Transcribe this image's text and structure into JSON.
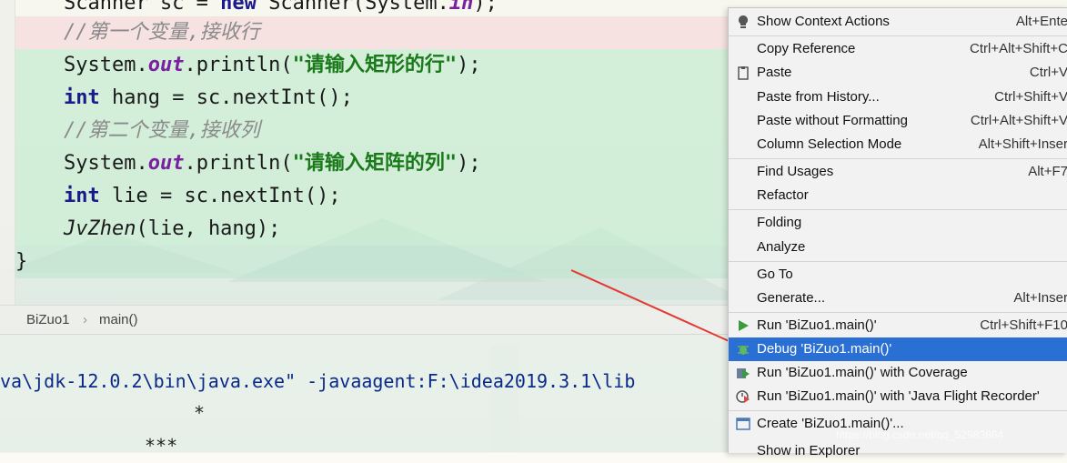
{
  "editor": {
    "lines": [
      {
        "code": "    Scanner sc = new Scanner(System.in);"
      },
      {
        "code": "    //第一个变量,接收行"
      },
      {
        "code": "    System.out.println(\"请输入矩形的行\");"
      },
      {
        "code": "    int hang = sc.nextInt();"
      },
      {
        "code": "    //第二个变量,接收列"
      },
      {
        "code": "    System.out.println(\"请输入矩阵的列\");"
      },
      {
        "code": "    int lie = sc.nextInt();"
      },
      {
        "code": "    JvZhen(lie, hang);"
      },
      {
        "code": "}"
      }
    ]
  },
  "breadcrumb": {
    "class_name": "BiZuo1",
    "separator": "›",
    "method": "main()"
  },
  "console": {
    "command": "va\\jdk-12.0.2\\bin\\java.exe\" -javaagent:F:\\idea2019.3.1\\lib",
    "line2": "*",
    "line3": "***"
  },
  "context_menu": {
    "items": [
      {
        "label": "Show Context Actions",
        "shortcut": "Alt+Ente",
        "icon": "bulb-icon"
      },
      {
        "label": "Copy Reference",
        "shortcut": "Ctrl+Alt+Shift+C"
      },
      {
        "label": "Paste",
        "shortcut": "Ctrl+V",
        "icon": "paste-icon"
      },
      {
        "label": "Paste from History...",
        "shortcut": "Ctrl+Shift+V"
      },
      {
        "label": "Paste without Formatting",
        "shortcut": "Ctrl+Alt+Shift+V"
      },
      {
        "label": "Column Selection Mode",
        "shortcut": "Alt+Shift+Inser"
      },
      {
        "label": "Find Usages",
        "shortcut": "Alt+F7"
      },
      {
        "label": "Refactor",
        "shortcut": ""
      },
      {
        "label": "Folding",
        "shortcut": ""
      },
      {
        "label": "Analyze",
        "shortcut": ""
      },
      {
        "label": "Go To",
        "shortcut": ""
      },
      {
        "label": "Generate...",
        "shortcut": "Alt+Inser"
      },
      {
        "label": "Run 'BiZuo1.main()'",
        "shortcut": "Ctrl+Shift+F10",
        "icon": "run-icon"
      },
      {
        "label": "Debug 'BiZuo1.main()'",
        "shortcut": "",
        "icon": "debug-icon",
        "selected": true
      },
      {
        "label": "Run 'BiZuo1.main()' with Coverage",
        "shortcut": "",
        "icon": "coverage-icon"
      },
      {
        "label": "Run 'BiZuo1.main()' with 'Java Flight Recorder'",
        "shortcut": "",
        "icon": "profiler-icon"
      },
      {
        "label": "Create 'BiZuo1.main()'...",
        "shortcut": "",
        "icon": "create-config-icon"
      },
      {
        "label": "Show in Explorer",
        "shortcut": ""
      }
    ]
  },
  "watermark": "https://blog.csdn.net/qq_52983864",
  "colors": {
    "accent": "#2a6fd3",
    "annotation_arrow": "#e53935",
    "string": "#1a7a1a",
    "keyword": "#1a1a8a",
    "field": "#7a1fa0"
  }
}
